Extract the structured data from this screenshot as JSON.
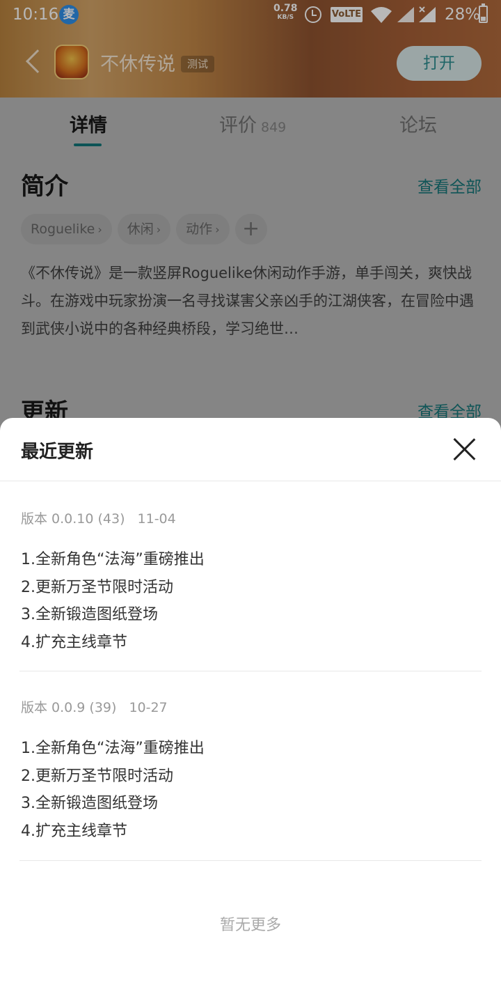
{
  "status_bar": {
    "time": "10:16",
    "app_badge": "麦",
    "net_speed": "0.78",
    "net_unit": "KB/S",
    "volte": "VoLTE",
    "battery": "28%"
  },
  "header": {
    "game_title": "不休传说",
    "test_tag": "测试",
    "open_button": "打开"
  },
  "tabs": [
    {
      "label": "详情",
      "count": ""
    },
    {
      "label": "评价",
      "count": "849"
    },
    {
      "label": "论坛",
      "count": ""
    }
  ],
  "intro": {
    "title": "简介",
    "see_all": "查看全部",
    "tags": [
      "Roguelike",
      "休闲",
      "动作"
    ],
    "text": "《不休传说》是一款竖屏Roguelike休闲动作手游，单手闯关，爽快战斗。在游戏中玩家扮演一名寻找谋害父亲凶手的江湖侠客，在冒险中遇到武侠小说中的各种经典桥段，学习绝世…"
  },
  "update": {
    "title": "更新",
    "see_all": "查看全部"
  },
  "sheet": {
    "title": "最近更新",
    "releases": [
      {
        "version": "版本 0.0.10 (43)",
        "date": "11-04",
        "notes": [
          "1.全新角色“法海”重磅推出",
          "2.更新万圣节限时活动",
          "3.全新锻造图纸登场",
          "4.扩充主线章节"
        ]
      },
      {
        "version": "版本 0.0.9 (39)",
        "date": "10-27",
        "notes": [
          "1.全新角色“法海”重磅推出",
          "2.更新万圣节限时活动",
          "3.全新锻造图纸登场",
          "4.扩充主线章节"
        ]
      }
    ],
    "no_more": "暂无更多"
  },
  "colors": {
    "accent": "#20a4a8",
    "header_brown": "#a86a3a"
  }
}
